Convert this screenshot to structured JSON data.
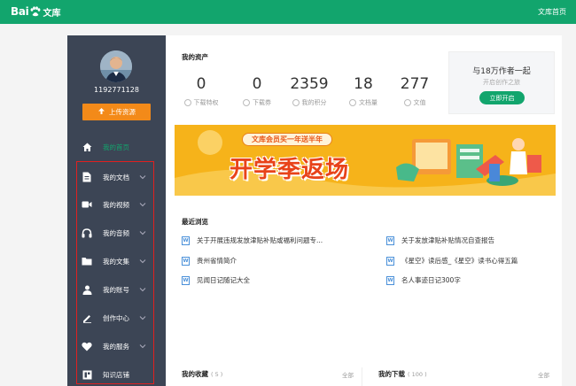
{
  "topbar": {
    "logo_bai": "Bai",
    "logo_wk": "文库",
    "home_link": "文库首页"
  },
  "sidebar": {
    "username": "1192771128",
    "upload_label": "上传资源",
    "items": [
      {
        "label": "我的首页",
        "icon": "home-icon",
        "active": true
      },
      {
        "label": "我的文档",
        "icon": "document-icon"
      },
      {
        "label": "我的视频",
        "icon": "video-icon"
      },
      {
        "label": "我的音频",
        "icon": "headphones-icon"
      },
      {
        "label": "我的文集",
        "icon": "folder-icon"
      },
      {
        "label": "我的账号",
        "icon": "user-icon"
      },
      {
        "label": "创作中心",
        "icon": "pen-icon"
      },
      {
        "label": "我的服务",
        "icon": "heart-icon"
      },
      {
        "label": "知识店铺",
        "icon": "store-icon"
      }
    ]
  },
  "assets": {
    "title": "我的资产",
    "stats": [
      {
        "value": "0",
        "label": "下载特权"
      },
      {
        "value": "0",
        "label": "下载券"
      },
      {
        "value": "2359",
        "label": "我的积分"
      },
      {
        "value": "18",
        "label": "文档量"
      },
      {
        "value": "277",
        "label": "文值"
      }
    ]
  },
  "invite": {
    "title": "与18万作者一起",
    "subtitle": "开启创作之旅",
    "button": "立即开启"
  },
  "banner": {
    "pill": "文库会员买一年送半年",
    "slogan": "开学季返场"
  },
  "recent": {
    "title": "最近浏览",
    "items": [
      "关于开展违规发放津贴补贴或福利问题专...",
      "关于发放津贴补贴情况自查报告",
      "贵州省情简介",
      "《星空》读后感_《星空》读书心得五篇",
      "见闻日记随记大全",
      "名人事迹日记300字"
    ]
  },
  "collections": {
    "title": "我的收藏",
    "count": "( 5 )",
    "all": "全部"
  },
  "downloads": {
    "title": "我的下载",
    "count": "( 100 )",
    "all": "全部"
  },
  "colors": {
    "brand_green": "#12a56d",
    "sidebar_bg": "#3c4555",
    "upload_orange": "#f38a19",
    "highlight_red": "#e02020"
  }
}
